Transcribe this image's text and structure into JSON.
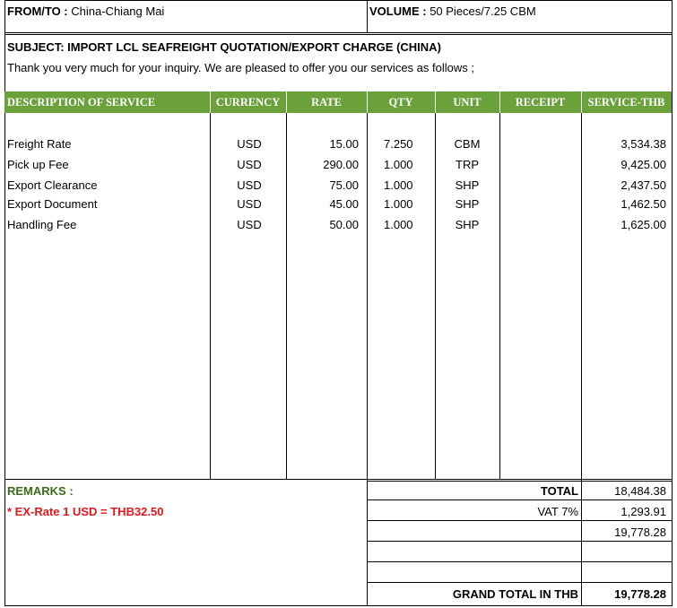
{
  "header": {
    "from_to_label": "FROM/TO :",
    "from_to_value": "China-Chiang Mai",
    "volume_label": "VOLUME :",
    "volume_value": "50 Pieces/7.25 CBM"
  },
  "subject": {
    "title": "SUBJECT: IMPORT LCL SEAFREIGHT QUOTATION/EXPORT CHARGE (CHINA)",
    "intro": "Thank you very much for your inquiry. We are pleased to offer you our services as follows ;"
  },
  "table": {
    "header_color": "#6aa13b",
    "columns": [
      "DESCRIPTION OF SERVICE",
      "CURRENCY",
      "RATE",
      "QTY",
      "UNIT",
      "RECEIPT",
      "SERVICE-THB"
    ],
    "rows": [
      {
        "desc": "Freight Rate",
        "currency": "USD",
        "rate": "15.00",
        "qty": "7.250",
        "unit": "CBM",
        "receipt": "",
        "service": "3,534.38"
      },
      {
        "desc": "Pick up Fee",
        "currency": "USD",
        "rate": "290.00",
        "qty": "1.000",
        "unit": "TRP",
        "receipt": "",
        "service": "9,425.00"
      },
      {
        "desc": "Export Clearance",
        "currency": "USD",
        "rate": "75.00",
        "qty": "1.000",
        "unit": "SHP",
        "receipt": "",
        "service": "2,437.50"
      },
      {
        "desc": "Export Document",
        "currency": "USD",
        "rate": "45.00",
        "qty": "1.000",
        "unit": "SHP",
        "receipt": "",
        "service": "1,462.50"
      },
      {
        "desc": "Handling Fee",
        "currency": "USD",
        "rate": "50.00",
        "qty": "1.000",
        "unit": "SHP",
        "receipt": "",
        "service": "1,625.00"
      }
    ]
  },
  "remarks": {
    "label": "REMARKS :",
    "exrate": "* EX-Rate 1 USD = THB32.50",
    "label_color": "#3a6d18",
    "exrate_color": "#e3161b"
  },
  "totals": {
    "total_label": "TOTAL",
    "total_value": "18,484.38",
    "vat_label": "VAT 7%",
    "vat_value": "1,293.91",
    "subtotal_value": "19,778.28",
    "grand_label": "GRAND TOTAL IN THB",
    "grand_value": "19,778.28"
  }
}
